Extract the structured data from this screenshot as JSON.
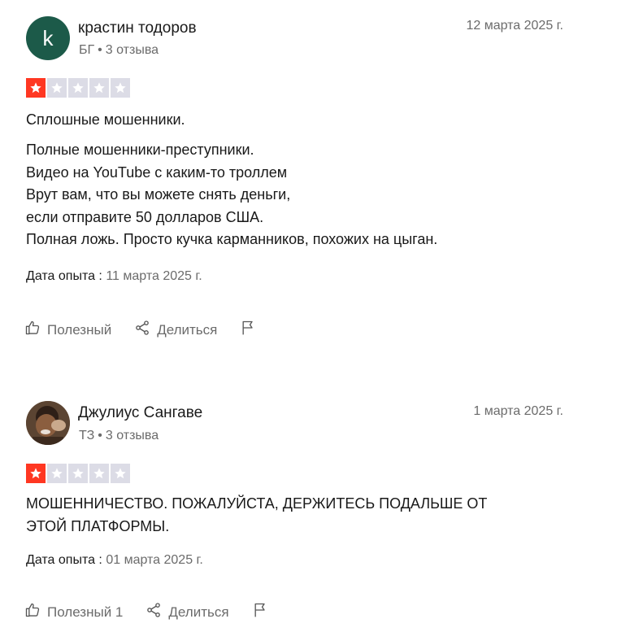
{
  "reviews": [
    {
      "avatar_letter": "k",
      "author": "крастин тодоров",
      "country": "БГ",
      "reviews_count": "3 отзыва",
      "date": "12 марта 2025 г.",
      "rating": 1,
      "star_color": "#ff3722",
      "title": "Сплошные мошенники.",
      "body": [
        "Полные мошенники-преступники.",
        "Видео на YouTube с каким-то троллем",
        "Врут вам, что вы можете снять деньги,",
        "если отправите 50 долларов США.",
        "Полная ложь. Просто кучка карманников, похожих на цыган."
      ],
      "experience_label": "Дата опыта :",
      "experience_date": "11 марта 2025 г.",
      "useful_label": "Полезный",
      "share_label": "Делиться"
    },
    {
      "author": "Джулиус Сангаве",
      "country": "ТЗ",
      "reviews_count": "3 отзыва",
      "date": "1 марта 2025 г.",
      "rating": 1,
      "star_color": "#ff3722",
      "body": [
        "МОШЕННИЧЕСТВО. ПОЖАЛУЙСТА, ДЕРЖИТЕСЬ ПОДАЛЬШЕ ОТ",
        "ЭТОЙ ПЛАТФОРМЫ."
      ],
      "experience_label": "Дата опыта :",
      "experience_date": "01 марта 2025 г.",
      "useful_label": "Полезный 1",
      "share_label": "Делиться"
    }
  ]
}
